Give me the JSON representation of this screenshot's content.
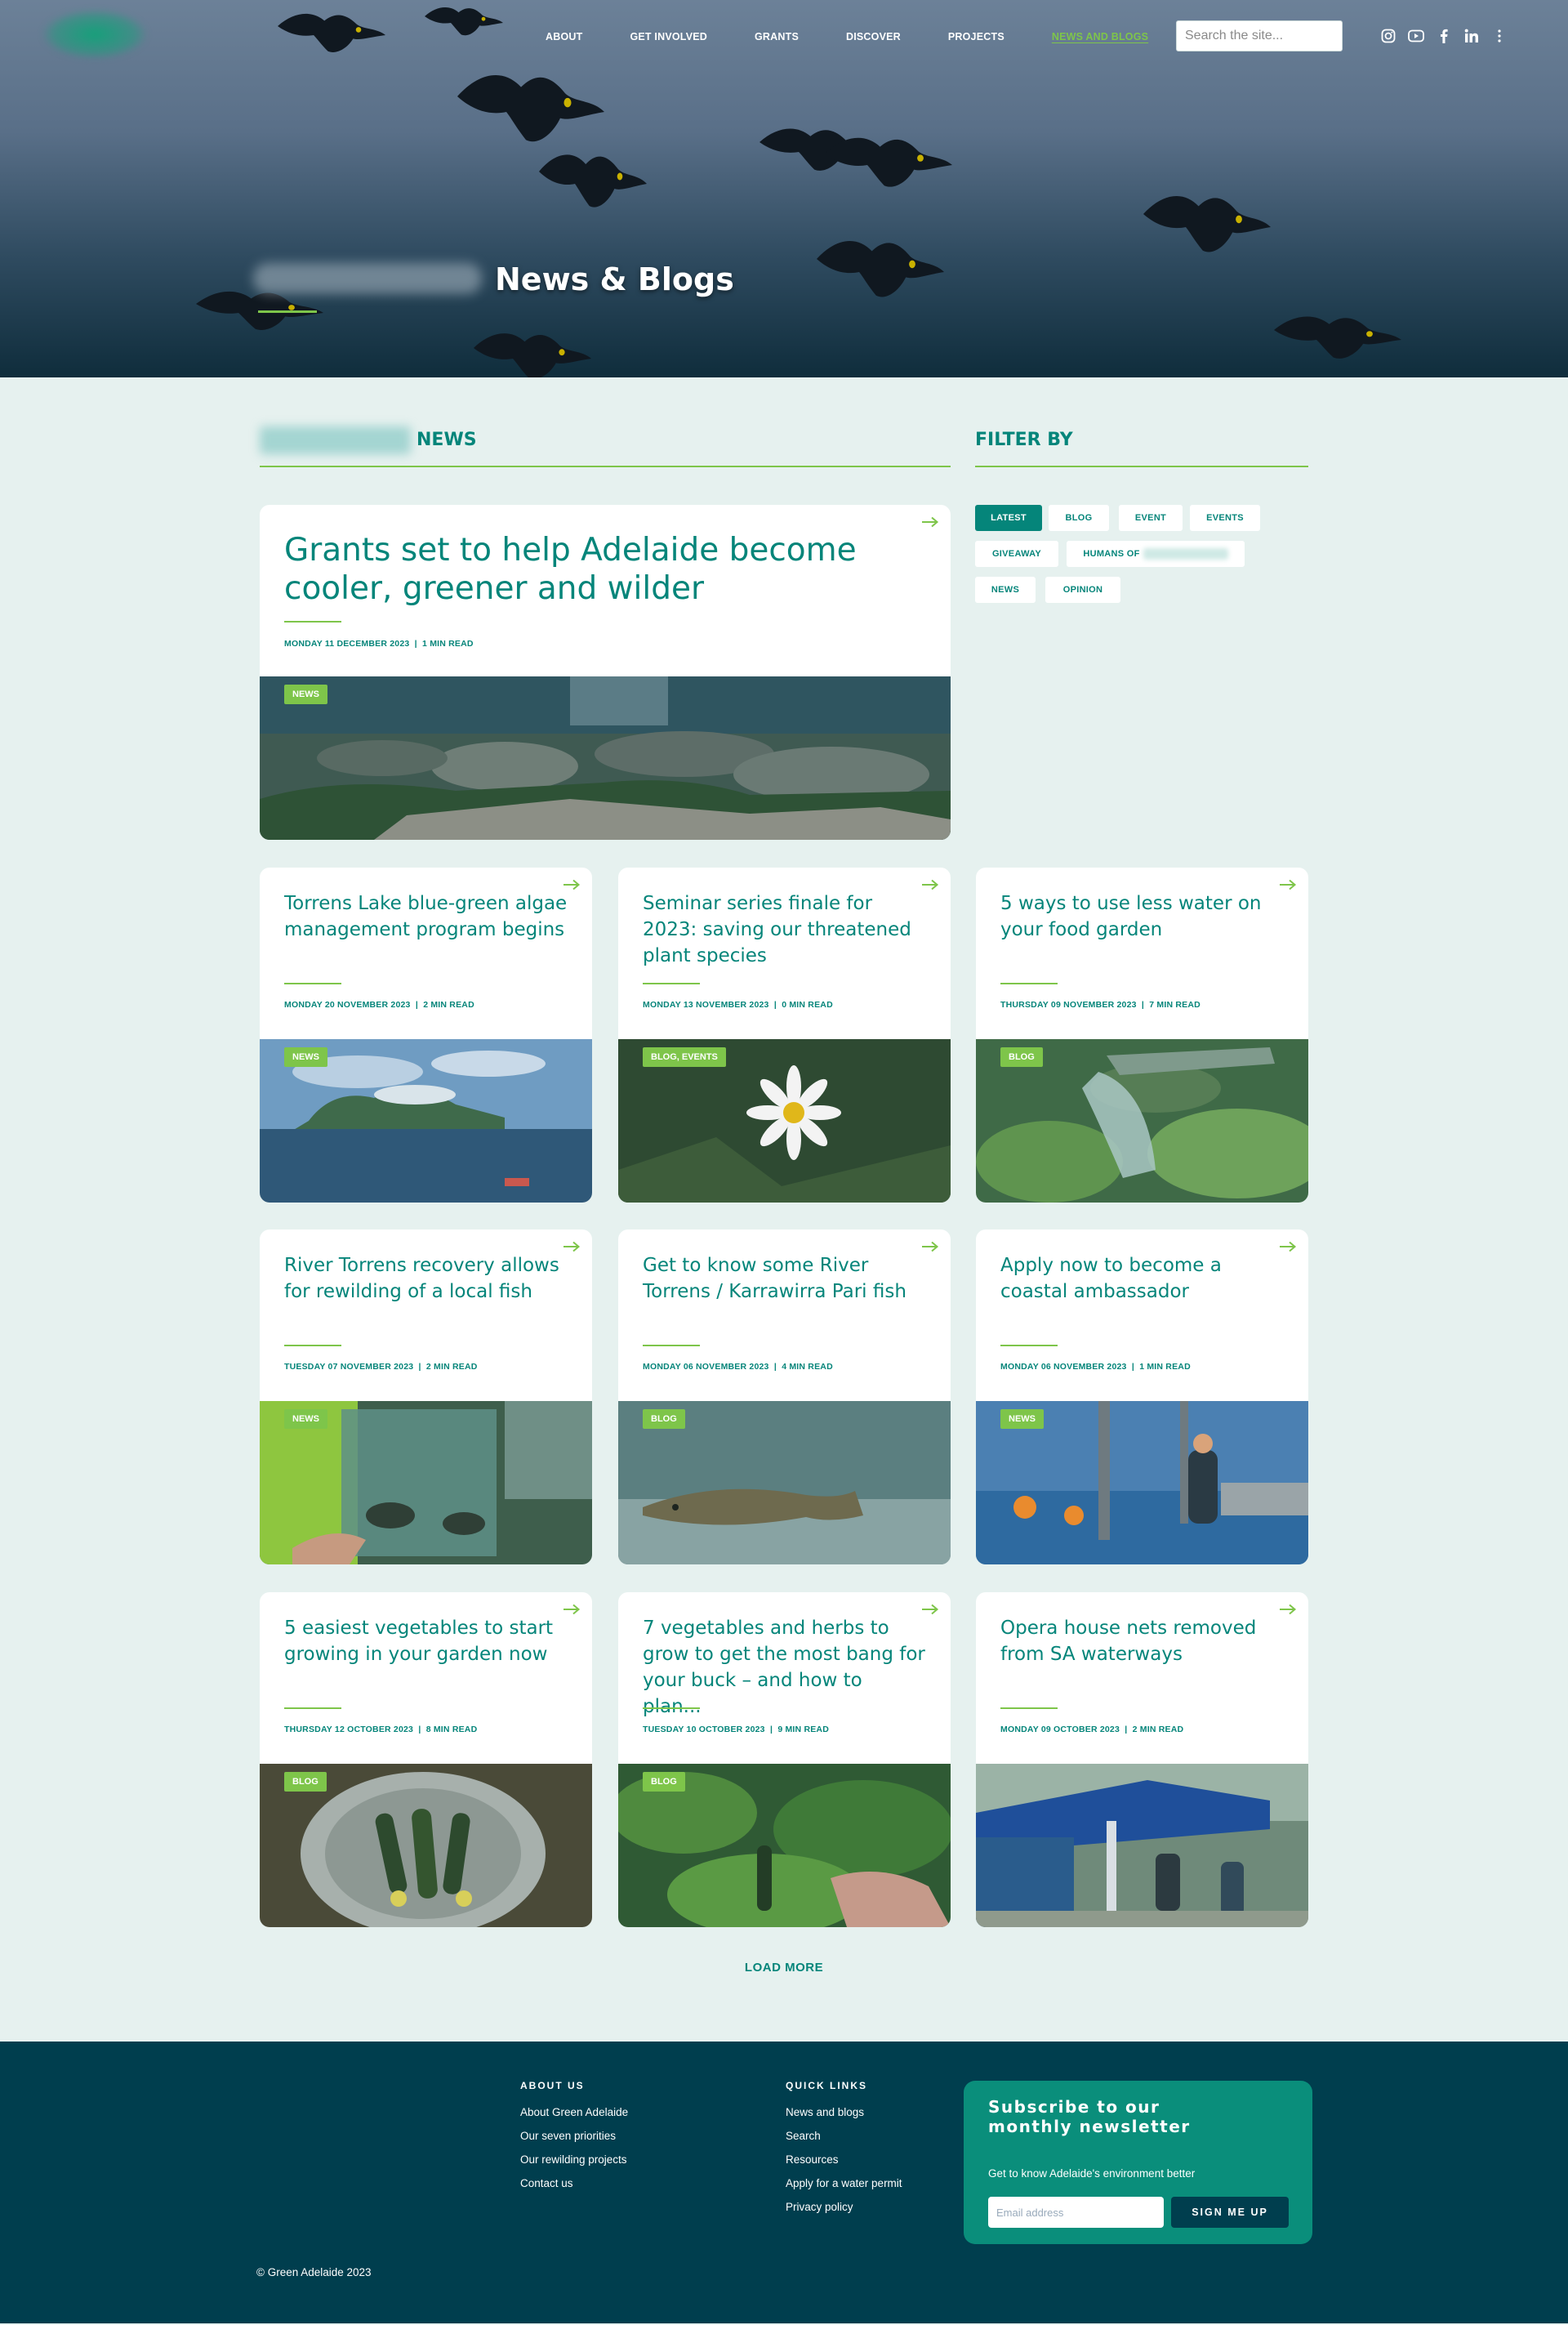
{
  "nav": {
    "items": [
      "ABOUT",
      "GET INVOLVED",
      "GRANTS",
      "DISCOVER",
      "PROJECTS",
      "NEWS AND BLOGS"
    ],
    "active": "NEWS AND BLOGS",
    "search_placeholder": "Search the site...",
    "social_icons": [
      "instagram-icon",
      "youtube-icon",
      "facebook-icon",
      "linkedin-icon",
      "more-icon"
    ]
  },
  "hero": {
    "title": "News & Blogs"
  },
  "news_section": {
    "heading": "NEWS"
  },
  "filter": {
    "heading": "FILTER BY",
    "chips": [
      "LATEST",
      "BLOG",
      "EVENT",
      "EVENTS",
      "GIVEAWAY",
      "HUMANS OF",
      "NEWS",
      "OPINION"
    ],
    "active": "LATEST"
  },
  "featured": {
    "title": "Grants set to help Adelaide become cooler, greener and wilder",
    "date": "MONDAY 11 DECEMBER 2023",
    "read": "1 MIN READ",
    "tag": "NEWS"
  },
  "articles": [
    {
      "title": "Torrens Lake blue-green algae management program begins",
      "date": "MONDAY 20 NOVEMBER 2023",
      "read": "2 MIN READ",
      "tag": "NEWS"
    },
    {
      "title": "Seminar series finale for 2023: saving our threatened plant species",
      "date": "MONDAY 13 NOVEMBER 2023",
      "read": "0 MIN READ",
      "tag": "BLOG, EVENTS"
    },
    {
      "title": "5 ways to use less water on your food garden",
      "date": "THURSDAY 09 NOVEMBER 2023",
      "read": "7 MIN READ",
      "tag": "BLOG"
    },
    {
      "title": "River Torrens recovery allows for rewilding of a local fish",
      "date": "TUESDAY 07 NOVEMBER 2023",
      "read": "2 MIN READ",
      "tag": "NEWS"
    },
    {
      "title": "Get to know some River Torrens / Karrawirra Pari fish",
      "date": "MONDAY 06 NOVEMBER 2023",
      "read": "4 MIN READ",
      "tag": "BLOG"
    },
    {
      "title": "Apply now to become a coastal ambassador",
      "date": "MONDAY 06 NOVEMBER 2023",
      "read": "1 MIN READ",
      "tag": "NEWS"
    },
    {
      "title": "5 easiest vegetables to start growing in your garden now",
      "date": "THURSDAY 12 OCTOBER 2023",
      "read": "8 MIN READ",
      "tag": "BLOG"
    },
    {
      "title": "7 vegetables and herbs to grow to get the most bang for your buck – and how to plan...",
      "date": "TUESDAY 10 OCTOBER 2023",
      "read": "9 MIN READ",
      "tag": "BLOG"
    },
    {
      "title": "Opera house nets removed from SA waterways",
      "date": "MONDAY 09 OCTOBER 2023",
      "read": "2 MIN READ",
      "tag": ""
    }
  ],
  "load_more": "LOAD MORE",
  "footer": {
    "about_heading": "ABOUT US",
    "about_links": [
      "About Green Adelaide",
      "Our seven priorities",
      "Our rewilding projects",
      "Contact us"
    ],
    "quick_heading": "QUICK LINKS",
    "quick_links": [
      "News and blogs",
      "Search",
      "Resources",
      "Apply for a water permit",
      "Privacy policy"
    ],
    "subscribe_title": "Subscribe to our monthly newsletter",
    "subscribe_text": "Get to know Adelaide's environment better",
    "email_placeholder": "Email address",
    "signup_label": "SIGN ME UP",
    "copyright": "© Green Adelaide 2023"
  },
  "colors": {
    "brand": "#05857a",
    "accent": "#7ec54a",
    "footer": "#003e4e",
    "page_bg": "#e6f1ef"
  }
}
